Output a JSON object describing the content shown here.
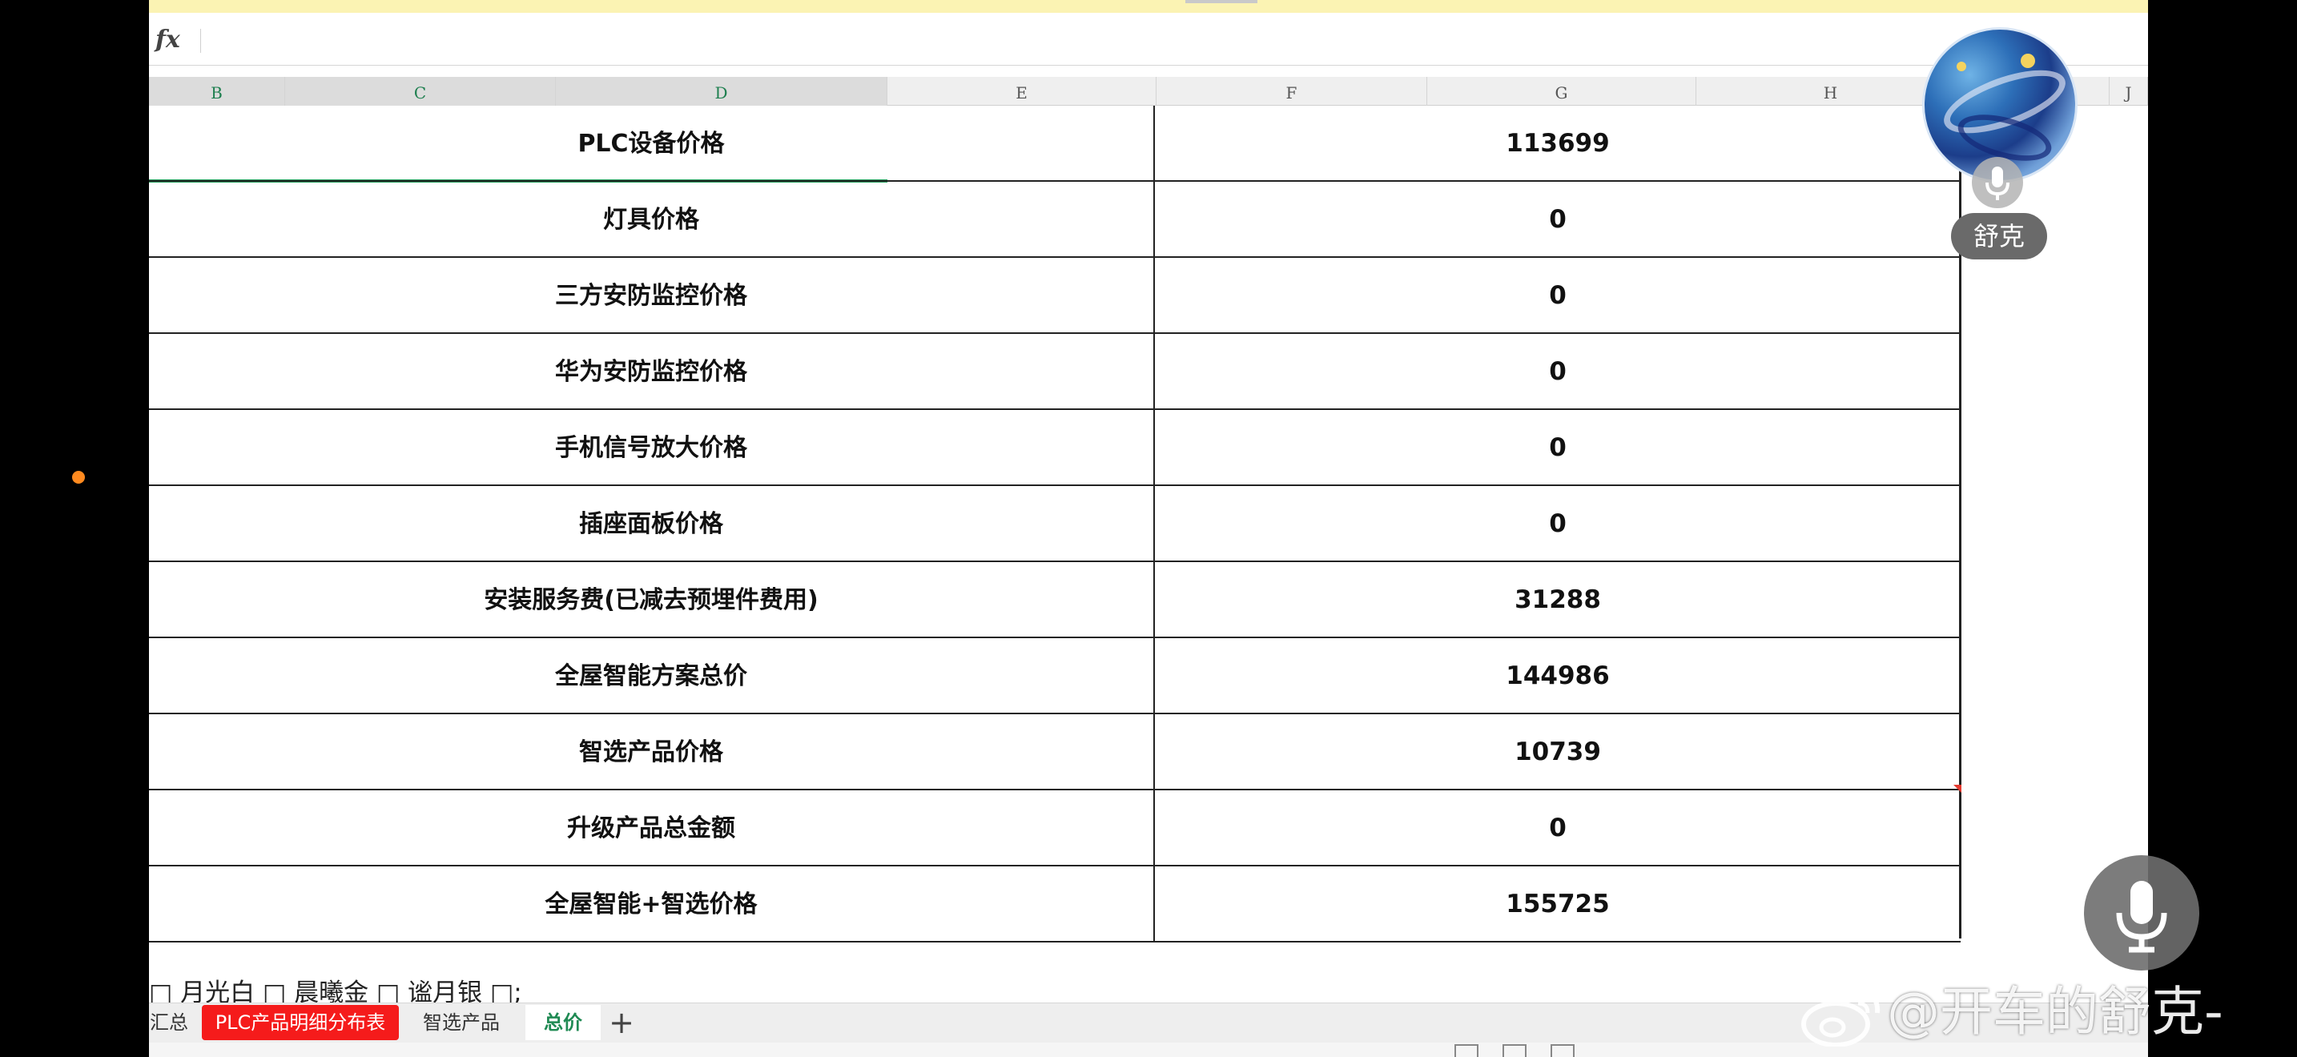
{
  "formula_bar": {
    "fx_label": "fx",
    "content": ""
  },
  "columns": [
    {
      "letter": "B",
      "selected": true
    },
    {
      "letter": "C",
      "selected": true
    },
    {
      "letter": "D",
      "selected": true
    },
    {
      "letter": "E",
      "selected": false
    },
    {
      "letter": "F",
      "selected": false
    },
    {
      "letter": "G",
      "selected": false
    },
    {
      "letter": "H",
      "selected": false
    },
    {
      "letter": "I",
      "selected": false
    },
    {
      "letter": "J",
      "selected": false
    }
  ],
  "rows": [
    {
      "label": "PLC设备价格",
      "value": "113699"
    },
    {
      "label": "灯具价格",
      "value": "0"
    },
    {
      "label": "三方安防监控价格",
      "value": "0"
    },
    {
      "label": "华为安防监控价格",
      "value": "0"
    },
    {
      "label": "手机信号放大价格",
      "value": "0"
    },
    {
      "label": "插座面板价格",
      "value": "0"
    },
    {
      "label": "安装服务费(已减去预埋件费用)",
      "value": "31288"
    },
    {
      "label": "全屋智能方案总价",
      "value": "144986"
    },
    {
      "label": "智选产品价格",
      "value": "10739"
    },
    {
      "label": "升级产品总金额",
      "value": "0"
    },
    {
      "label": "全屋智能+智选价格",
      "value": "155725"
    }
  ],
  "bottom_text": [
    "□ 月光白 □ 晨曦金 □ 谧月银 □;"
  ],
  "sheet_tabs": [
    {
      "label": "汇总",
      "style": "normal"
    },
    {
      "label": "PLC产品明细分布表",
      "style": "red"
    },
    {
      "label": "智选产品",
      "style": "normal"
    },
    {
      "label": "总价",
      "style": "active"
    }
  ],
  "add_sheet_label": "+",
  "status_bar_text": "",
  "overlay": {
    "participant_name": "舒克",
    "watermark": "@开车的舒克-"
  },
  "colors": {
    "selection_green": "#1f9e5b",
    "red_tab": "#f51b1b",
    "top_strip": "#fbf3b3"
  }
}
